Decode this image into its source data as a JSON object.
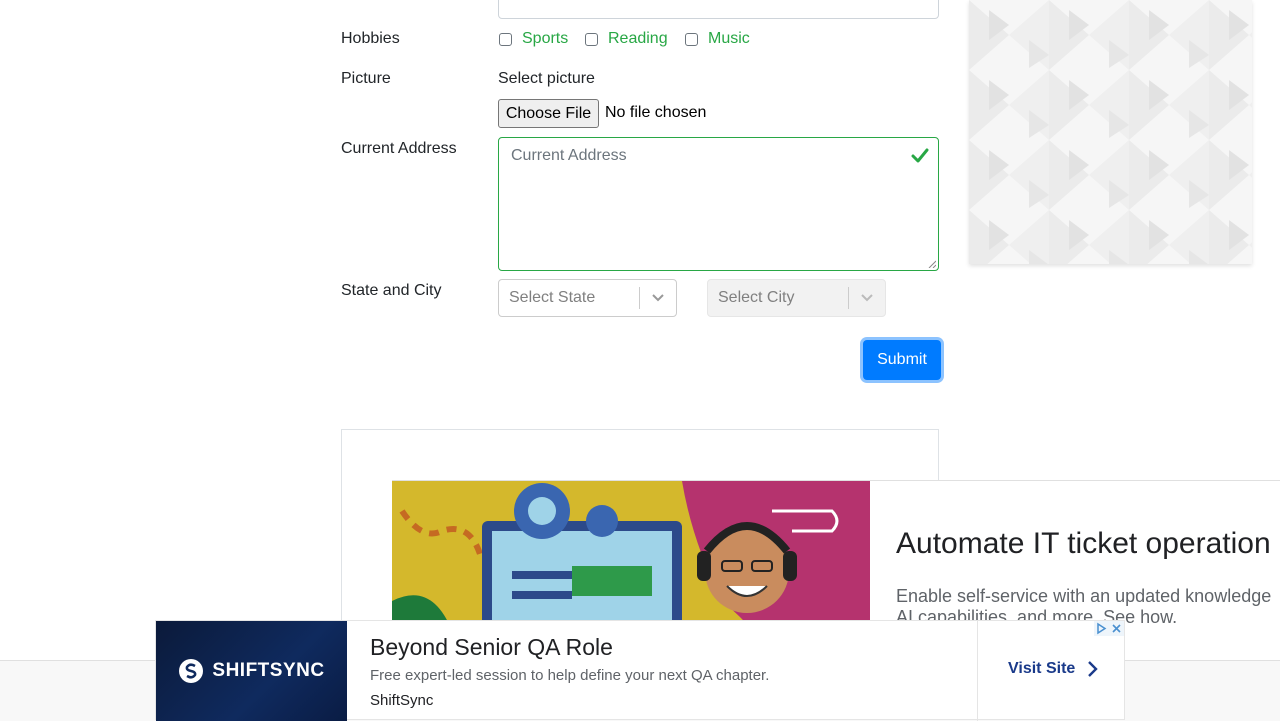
{
  "form": {
    "hobbies_label": "Hobbies",
    "hobbies": [
      {
        "label": "Sports",
        "checked": false
      },
      {
        "label": "Reading",
        "checked": false
      },
      {
        "label": "Music",
        "checked": false
      }
    ],
    "picture_label": "Picture",
    "picture_hint": "Select picture",
    "file_button": "Choose File",
    "file_status": "No file chosen",
    "address_label": "Current Address",
    "address_placeholder": "Current Address",
    "state_city_label": "State and City",
    "state_placeholder": "Select State",
    "city_placeholder": "Select City",
    "submit_label": "Submit"
  },
  "ad_main": {
    "title": "Automate IT ticket operation",
    "description_line1": "Enable self-service with an updated knowledge",
    "description_line2": "AI capabilities, and more. See how."
  },
  "bottom_ad": {
    "logo_text": "SHIFTSYNC",
    "title": "Beyond Senior QA Role",
    "description": "Free expert-led session to help define your next QA chapter.",
    "brand": "ShiftSync",
    "cta": "Visit Site"
  },
  "colors": {
    "accent": "#007bff",
    "valid": "#28a745",
    "text": "#212529",
    "placeholder": "#6c757d"
  },
  "icons": {
    "valid": "checkmark-icon",
    "dropdown": "chevron-down-icon",
    "cta": "chevron-right-icon"
  }
}
